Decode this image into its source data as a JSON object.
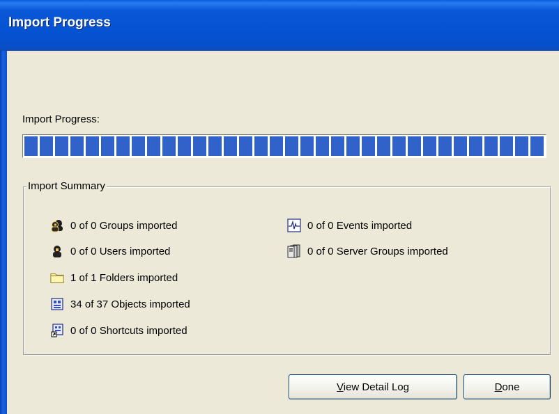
{
  "window": {
    "title": "Import Progress"
  },
  "progress": {
    "label": "Import Progress:",
    "fraction": 1.0
  },
  "summary": {
    "legend": "Import Summary",
    "left": [
      {
        "text": "0 of 0 Groups imported",
        "icon": "groups-icon"
      },
      {
        "text": "0 of 0 Users imported",
        "icon": "user-icon"
      },
      {
        "text": "1 of 1 Folders imported",
        "icon": "folder-icon"
      },
      {
        "text": "34 of 37 Objects imported",
        "icon": "object-icon"
      },
      {
        "text": "0 of 0 Shortcuts imported",
        "icon": "shortcut-icon"
      }
    ],
    "right": [
      {
        "text": "0 of 0 Events imported",
        "icon": "event-icon"
      },
      {
        "text": "0 of 0 Server Groups imported",
        "icon": "server-groups-icon"
      }
    ]
  },
  "buttons": {
    "view_log_access": "V",
    "view_log_rest": "iew Detail Log",
    "done_access": "D",
    "done_rest": "one"
  },
  "colors": {
    "titlebar": "#0553d2",
    "progress_block": "#3162c9",
    "face": "#ece9d8"
  }
}
